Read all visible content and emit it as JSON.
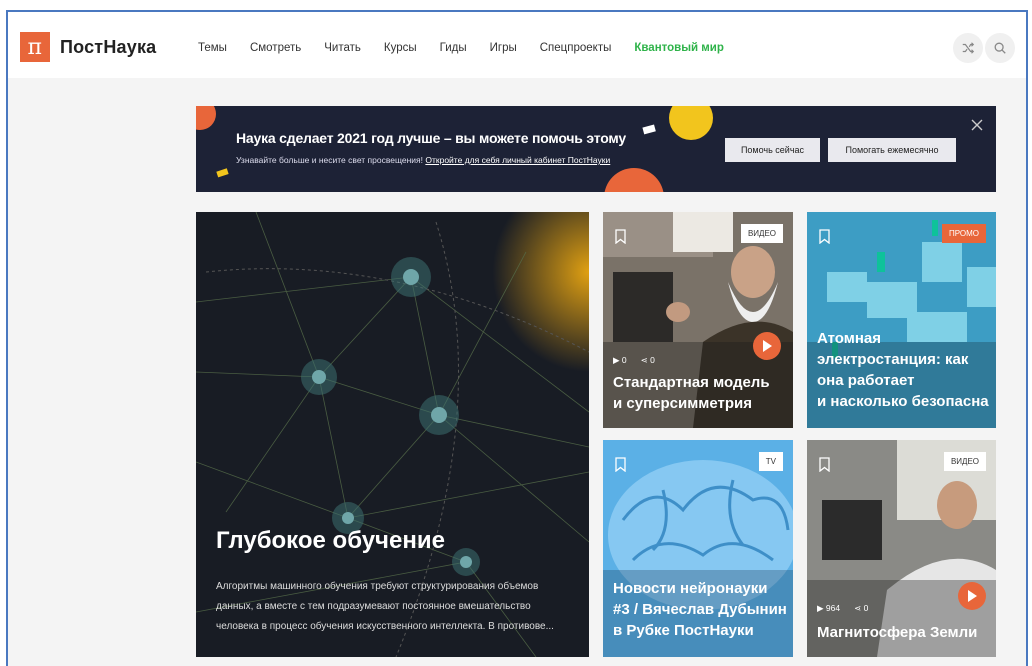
{
  "header": {
    "logo_letter": "п",
    "logo_text": "ПостНаука",
    "nav": [
      "Темы",
      "Смотреть",
      "Читать",
      "Курсы",
      "Гиды",
      "Игры",
      "Спецпроекты"
    ],
    "nav_accent": "Квантовый мир",
    "brand_color": "#e8663a",
    "accent_color": "#2fb34a"
  },
  "banner": {
    "title": "Наука сделает 2021 год лучше – вы можете помочь этому",
    "subtitle_text": "Узнавайте больше и несите свет просвещения!",
    "subtitle_link": "Откройте для себя личный кабинет ПостНауки",
    "btn_now": "Помочь сейчас",
    "btn_monthly": "Помогать ежемесячно"
  },
  "feature": {
    "title": "Глубокое обучение",
    "description": "Алгоритмы машинного обучения требуют структурирования объемов данных, а вместе с тем подразумевают постоянное вмешательство человека в процесс обучения искусственного интеллекта. В противове..."
  },
  "cards": [
    {
      "badge": "ВИДЕО",
      "title_line1": "Стандартная модель",
      "title_line2": "и суперсимметрия",
      "views": "0",
      "shares": "0"
    },
    {
      "badge": "ПРОМО",
      "title_line1": "Атомная",
      "title_line2": "электростанция: как",
      "title_line3": "она работает",
      "title_line4": "и насколько безопасна"
    },
    {
      "badge": "TV",
      "title_line1": "Новости нейронауки",
      "title_line2": "#3 / Вячеслав Дубынин",
      "title_line3": "в Рубке ПостНауки"
    },
    {
      "badge": "ВИДЕО",
      "title_line1": "Магнитосфера Земли",
      "views": "964",
      "shares": "0"
    }
  ]
}
